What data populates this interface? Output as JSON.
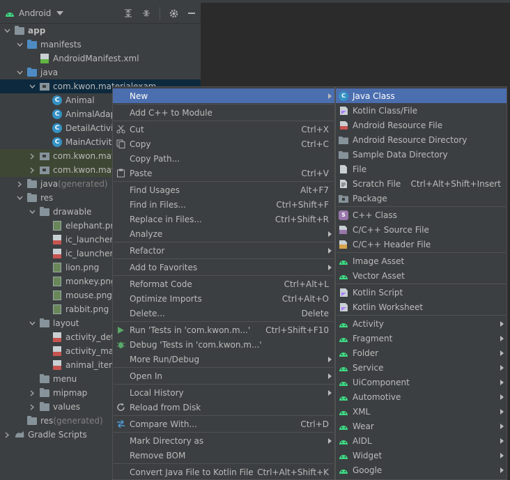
{
  "toolbar": {
    "title": "Android"
  },
  "tree": [
    {
      "label": "app",
      "arrow": "down",
      "icon": "module",
      "indent": 0,
      "bold": true
    },
    {
      "label": "manifests",
      "arrow": "down",
      "icon": "folder-blue",
      "indent": 1
    },
    {
      "label": "AndroidManifest.xml",
      "arrow": "",
      "icon": "manifest",
      "indent": 2
    },
    {
      "label": "java",
      "arrow": "down",
      "icon": "folder-blue",
      "indent": 1
    },
    {
      "label": "com.kwon.materialexam",
      "arrow": "down",
      "icon": "package",
      "indent": 2,
      "selected": true
    },
    {
      "label": "Animal",
      "arrow": "",
      "icon": "class",
      "indent": 3
    },
    {
      "label": "AnimalAdap",
      "arrow": "",
      "icon": "class",
      "indent": 3
    },
    {
      "label": "DetailActivit",
      "arrow": "",
      "icon": "class",
      "indent": 3
    },
    {
      "label": "MainActivity",
      "arrow": "",
      "icon": "class",
      "indent": 3
    },
    {
      "label": "com.kwon.mate",
      "arrow": "right",
      "icon": "package",
      "indent": 2,
      "highlight": true
    },
    {
      "label": "com.kwon.mate",
      "arrow": "right",
      "icon": "package",
      "indent": 2,
      "highlight": true
    },
    {
      "label": "java",
      "suffix": " (generated)",
      "arrow": "right",
      "icon": "folder-gen",
      "indent": 1
    },
    {
      "label": "res",
      "arrow": "down",
      "icon": "folder-res",
      "indent": 1
    },
    {
      "label": "drawable",
      "arrow": "down",
      "icon": "folder",
      "indent": 2
    },
    {
      "label": "elephant.png",
      "arrow": "",
      "icon": "image",
      "indent": 3
    },
    {
      "label": "ic_launcher_",
      "arrow": "",
      "icon": "xml",
      "indent": 3
    },
    {
      "label": "ic_launcher_",
      "arrow": "",
      "icon": "xml",
      "indent": 3
    },
    {
      "label": "lion.png",
      "arrow": "",
      "icon": "image",
      "indent": 3
    },
    {
      "label": "monkey.png",
      "arrow": "",
      "icon": "image",
      "indent": 3
    },
    {
      "label": "mouse.png",
      "arrow": "",
      "icon": "image",
      "indent": 3
    },
    {
      "label": "rabbit.png",
      "arrow": "",
      "icon": "image",
      "indent": 3
    },
    {
      "label": "layout",
      "arrow": "down",
      "icon": "folder",
      "indent": 2
    },
    {
      "label": "activity_deta",
      "arrow": "",
      "icon": "xml",
      "indent": 3
    },
    {
      "label": "activity_mair",
      "arrow": "",
      "icon": "xml",
      "indent": 3
    },
    {
      "label": "animal_item",
      "arrow": "",
      "icon": "xml",
      "indent": 3
    },
    {
      "label": "menu",
      "arrow": "",
      "icon": "folder",
      "indent": 2
    },
    {
      "label": "mipmap",
      "arrow": "right",
      "icon": "folder",
      "indent": 2
    },
    {
      "label": "values",
      "arrow": "right",
      "icon": "folder",
      "indent": 2
    },
    {
      "label": "res",
      "suffix": " (generated)",
      "arrow": "",
      "icon": "folder-res",
      "indent": 1
    },
    {
      "label": "Gradle Scripts",
      "arrow": "right",
      "icon": "gradle",
      "indent": 0
    }
  ],
  "context_menu": [
    {
      "label": "New",
      "submenu": true,
      "active": true
    },
    {
      "sep": true
    },
    {
      "label": "Add C++ to Module"
    },
    {
      "sep": true
    },
    {
      "label": "Cut",
      "shortcut": "Ctrl+X",
      "icon": "cut-icon"
    },
    {
      "label": "Copy",
      "shortcut": "Ctrl+C",
      "icon": "copy-icon"
    },
    {
      "label": "Copy Path...",
      "submenu": false
    },
    {
      "label": "Paste",
      "shortcut": "Ctrl+V",
      "icon": "paste-icon"
    },
    {
      "sep": true
    },
    {
      "label": "Find Usages",
      "shortcut": "Alt+F7"
    },
    {
      "label": "Find in Files...",
      "shortcut": "Ctrl+Shift+F"
    },
    {
      "label": "Replace in Files...",
      "shortcut": "Ctrl+Shift+R"
    },
    {
      "label": "Analyze",
      "submenu": true
    },
    {
      "sep": true
    },
    {
      "label": "Refactor",
      "submenu": true
    },
    {
      "sep": true
    },
    {
      "label": "Add to Favorites",
      "submenu": true
    },
    {
      "sep": true
    },
    {
      "label": "Reformat Code",
      "shortcut": "Ctrl+Alt+L"
    },
    {
      "label": "Optimize Imports",
      "shortcut": "Ctrl+Alt+O"
    },
    {
      "label": "Delete...",
      "shortcut": "Delete"
    },
    {
      "sep": true
    },
    {
      "label": "Run 'Tests in 'com.kwon.m...'",
      "shortcut": "Ctrl+Shift+F10",
      "icon": "run-icon"
    },
    {
      "label": "Debug 'Tests in 'com.kwon.m...'",
      "icon": "debug-icon"
    },
    {
      "label": "More Run/Debug",
      "submenu": true
    },
    {
      "sep": true
    },
    {
      "label": "Open In",
      "submenu": true
    },
    {
      "sep": true
    },
    {
      "label": "Local History",
      "submenu": true
    },
    {
      "label": "Reload from Disk",
      "icon": "reload-icon"
    },
    {
      "sep": true
    },
    {
      "label": "Compare With...",
      "shortcut": "Ctrl+D",
      "icon": "compare-icon"
    },
    {
      "sep": true
    },
    {
      "label": "Mark Directory as",
      "submenu": true
    },
    {
      "label": "Remove BOM"
    },
    {
      "sep": true
    },
    {
      "label": "Convert Java File to Kotlin File",
      "shortcut": "Ctrl+Alt+Shift+K"
    }
  ],
  "sub_menu": [
    {
      "label": "Java Class",
      "icon": "java-class-icon",
      "active": true
    },
    {
      "label": "Kotlin Class/File",
      "icon": "kotlin-file-icon"
    },
    {
      "label": "Android Resource File",
      "icon": "resource-file-icon"
    },
    {
      "label": "Android Resource Directory",
      "icon": "folder-icon"
    },
    {
      "label": "Sample Data Directory",
      "icon": "folder-icon"
    },
    {
      "label": "File",
      "icon": "file-icon"
    },
    {
      "label": "Scratch File",
      "shortcut": "Ctrl+Alt+Shift+Insert",
      "icon": "scratch-file-icon"
    },
    {
      "label": "Package",
      "icon": "package-icon"
    },
    {
      "sep": true
    },
    {
      "label": "C++ Class",
      "icon": "cpp-class-icon"
    },
    {
      "label": "C/C++ Source File",
      "icon": "cpp-source-icon"
    },
    {
      "label": "C/C++ Header File",
      "icon": "cpp-header-icon"
    },
    {
      "sep": true
    },
    {
      "label": "Image Asset",
      "icon": "android-icon"
    },
    {
      "label": "Vector Asset",
      "icon": "android-icon"
    },
    {
      "sep": true
    },
    {
      "label": "Kotlin Script",
      "icon": "kotlin-script-icon"
    },
    {
      "label": "Kotlin Worksheet",
      "icon": "kotlin-worksheet-icon"
    },
    {
      "sep": true
    },
    {
      "label": "Activity",
      "icon": "android-icon",
      "submenu": true
    },
    {
      "label": "Fragment",
      "icon": "android-icon",
      "submenu": true
    },
    {
      "label": "Folder",
      "icon": "android-icon",
      "submenu": true
    },
    {
      "label": "Service",
      "icon": "android-icon",
      "submenu": true
    },
    {
      "label": "UiComponent",
      "icon": "android-icon",
      "submenu": true
    },
    {
      "label": "Automotive",
      "icon": "android-icon",
      "submenu": true
    },
    {
      "label": "XML",
      "icon": "android-icon",
      "submenu": true
    },
    {
      "label": "Wear",
      "icon": "android-icon",
      "submenu": true
    },
    {
      "label": "AIDL",
      "icon": "android-icon",
      "submenu": true
    },
    {
      "label": "Widget",
      "icon": "android-icon",
      "submenu": true
    },
    {
      "label": "Google",
      "icon": "android-icon",
      "submenu": true
    }
  ],
  "colors": {
    "accent": "#4b6eaf",
    "android_green": "#3ddc84",
    "class_blue": "#3592c4"
  }
}
